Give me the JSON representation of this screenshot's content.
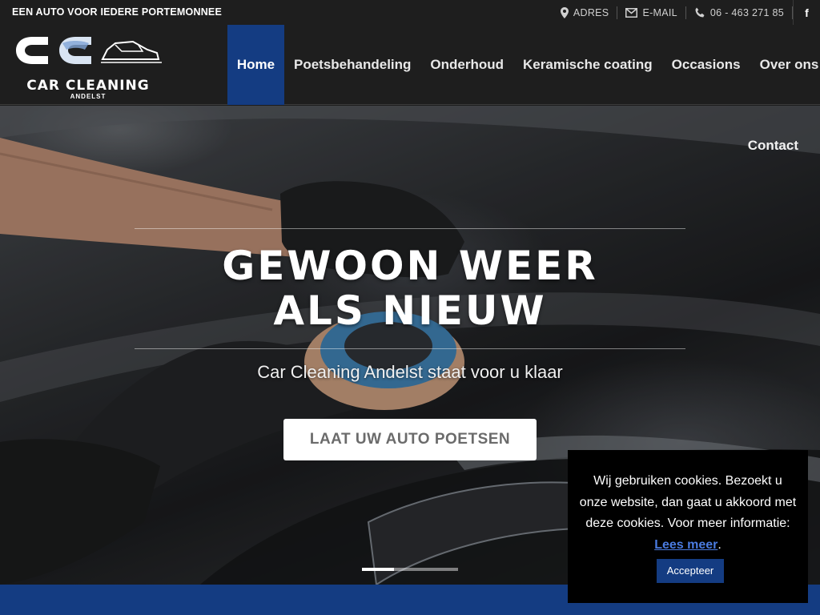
{
  "topbar": {
    "tagline": "EEN AUTO VOOR IEDERE PORTEMONNEE",
    "links": [
      {
        "icon": "map-pin-icon",
        "label": "ADRES"
      },
      {
        "icon": "envelope-icon",
        "label": "E-MAIL"
      },
      {
        "icon": "phone-icon",
        "label": "06 - 463 271 85"
      }
    ],
    "social": "f"
  },
  "logo": {
    "monogram": "CC",
    "name": "CAR CLEANING",
    "location": "ANDELST"
  },
  "nav": {
    "items": [
      "Home",
      "Poetsbehandeling",
      "Onderhoud",
      "Keramische coating",
      "Occasions",
      "Over ons"
    ],
    "active": "Home",
    "contact": "Contact"
  },
  "hero": {
    "title_line1": "GEWOON WEER",
    "title_line2": "ALS NIEUW",
    "subtitle": "Car Cleaning Andelst staat voor u klaar",
    "button": "LAAT UW AUTO POETSEN",
    "slide_count": 3,
    "active_slide": 1
  },
  "cookie": {
    "text": "Wij gebruiken cookies. Bezoekt u onze website, dan gaat u akkoord met deze cookies. Voor meer informatie:",
    "link": "Lees meer",
    "after_link": ".",
    "button": "Accepteer"
  },
  "colors": {
    "accent": "#143c82",
    "topbar": "#1e1e1e",
    "link": "#4a7be0"
  }
}
